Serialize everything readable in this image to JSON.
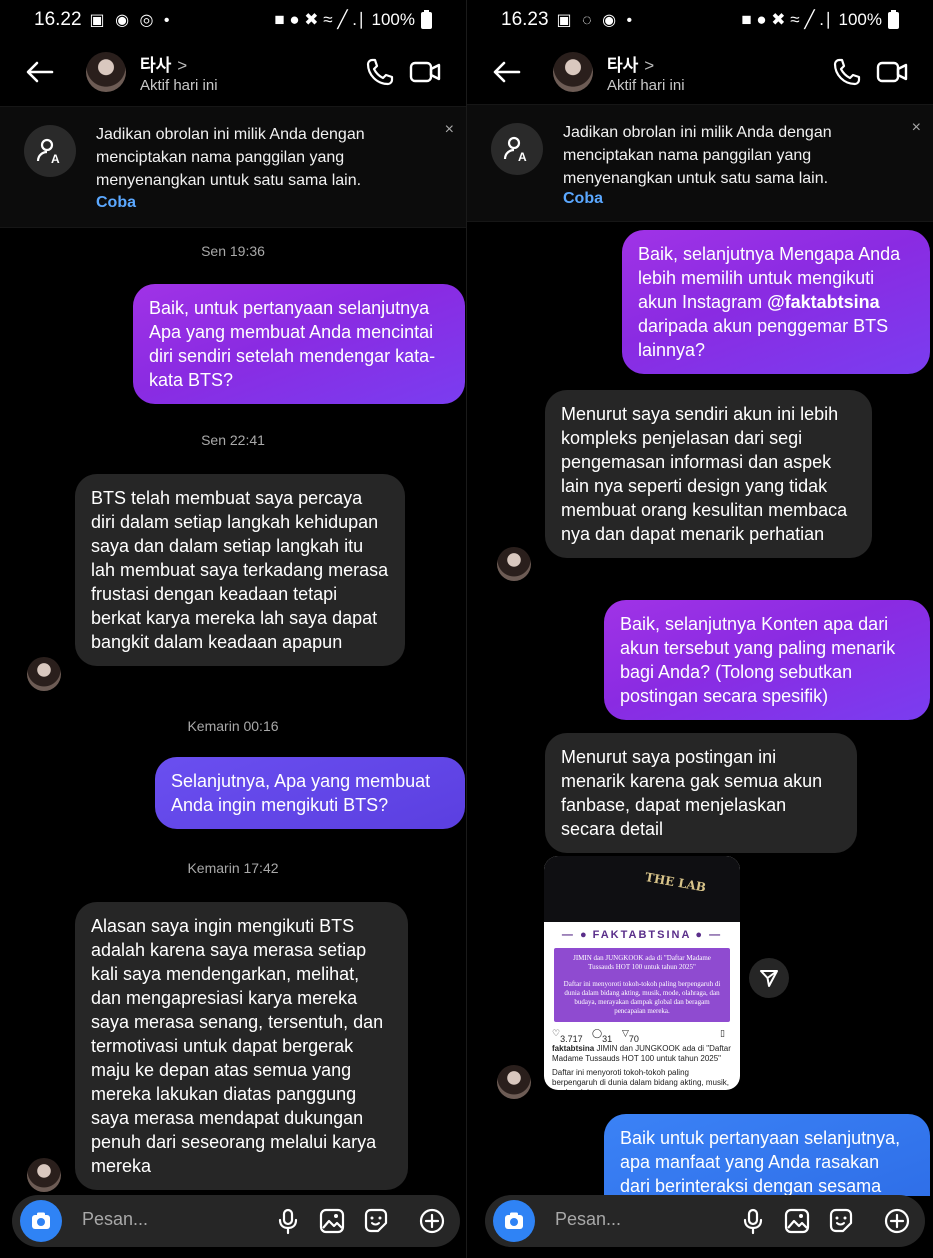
{
  "left": {
    "status": {
      "time": "16.22",
      "icons": "▣ ◉ ◎ •",
      "right": "■ ● ✖ ≈ ╱ .∣",
      "battery": "100%"
    },
    "header": {
      "name": "타사",
      "chevron": ">",
      "status": "Aktif hari ini"
    },
    "nickname": {
      "text": "Jadikan obrolan ini milik Anda dengan menciptakan nama panggilan yang menyenangkan untuk satu sama lain.",
      "link": "Coba",
      "close": "×"
    },
    "timestamps": [
      "Sen 19:36",
      "Sen 22:41",
      "Kemarin 00:16",
      "Kemarin 17:42"
    ],
    "messages": [
      "Baik, untuk pertanyaan selanjutnya Apa yang membuat Anda mencintai diri sendiri setelah mendengar kata-kata BTS?",
      "BTS telah membuat saya percaya diri dalam setiap langkah kehidupan saya dan dalam setiap langkah itu lah membuat saya terkadang merasa frustasi dengan keadaan tetapi berkat karya mereka lah saya dapat bangkit dalam keadaan apapun",
      "Selanjutnya, Apa yang membuat Anda ingin mengikuti BTS?",
      "Alasan saya ingin mengikuti BTS adalah karena saya merasa setiap kali saya mendengarkan, melihat, dan mengapresiasi karya mereka saya merasa senang, tersentuh, dan termotivasi untuk dapat bergerak maju ke depan atas semua yang mereka lakukan diatas panggung saya merasa mendapat dukungan penuh dari seseorang melalui karya mereka"
    ],
    "composer": {
      "placeholder": "Pesan..."
    }
  },
  "right": {
    "status": {
      "time": "16.23",
      "icons": "▣ ◌ ◉ •",
      "right": "■ ● ✖ ≈ ╱ .∣",
      "battery": "100%"
    },
    "header": {
      "name": "타사",
      "chevron": ">",
      "status": "Aktif hari ini"
    },
    "nickname": {
      "text": "Jadikan obrolan ini milik Anda dengan menciptakan nama panggilan yang menyenangkan untuk satu sama lain.",
      "link": "Coba",
      "close": "×"
    },
    "messages": [
      {
        "pre": "Baik, selanjutnya Mengapa Anda lebih memilih untuk mengikuti akun Instagram ",
        "handle": "@faktabtsina",
        "post": " daripada akun penggemar BTS lainnya?"
      },
      "Menurut saya sendiri akun ini lebih kompleks penjelasan dari segi pengemasan informasi dan aspek lain nya seperti design yang tidak membuat orang kesulitan membaca nya dan dapat menarik perhatian",
      "Baik, selanjutnya Konten apa dari akun tersebut yang paling menarik bagi Anda? (Tolong sebutkan postingan secara spesifik)",
      "Menurut saya postingan ini menarik karena gak semua akun fanbase, dapat menjelaskan secara detail",
      "Baik untuk pertanyaan selanjutnya, apa manfaat yang Anda rasakan dari berinteraksi dengan sesama"
    ],
    "post": {
      "photo_text": "THE LAB",
      "banner": "FAKTABTSINA",
      "card_title": "JIMIN dan JUNGKOOK ada di \"Daftar Madame Tussauds HOT 100 untuk tahun 2025\"",
      "card_body": "Daftar ini menyoroti tokoh-tokoh paling berpengaruh di dunia dalam bidang akting, musik, mode, olahraga, dan budaya, merayakan dampak global dan beragam pencapaian mereka.",
      "likes": "3.717",
      "comments": "31",
      "shares": "70",
      "caption_user": "faktabtsina",
      "caption": " JIMIN dan JUNGKOOK ada di \"Daftar Madame Tussauds HOT 100 untuk tahun 2025\"",
      "desc": "Daftar ini menyoroti tokoh-tokoh paling berpengaruh di dunia dalam bidang akting, musik, mode, olahraga"
    },
    "composer": {
      "placeholder": "Pesan..."
    }
  },
  "colors": {
    "bubble_out": "#8a2be2",
    "bubble_out_late": "#5b3fe0",
    "bubble_blue": "#2f6fe8",
    "bubble_in": "#262626",
    "link": "#5ba8ff",
    "camera": "#2f83f5"
  }
}
